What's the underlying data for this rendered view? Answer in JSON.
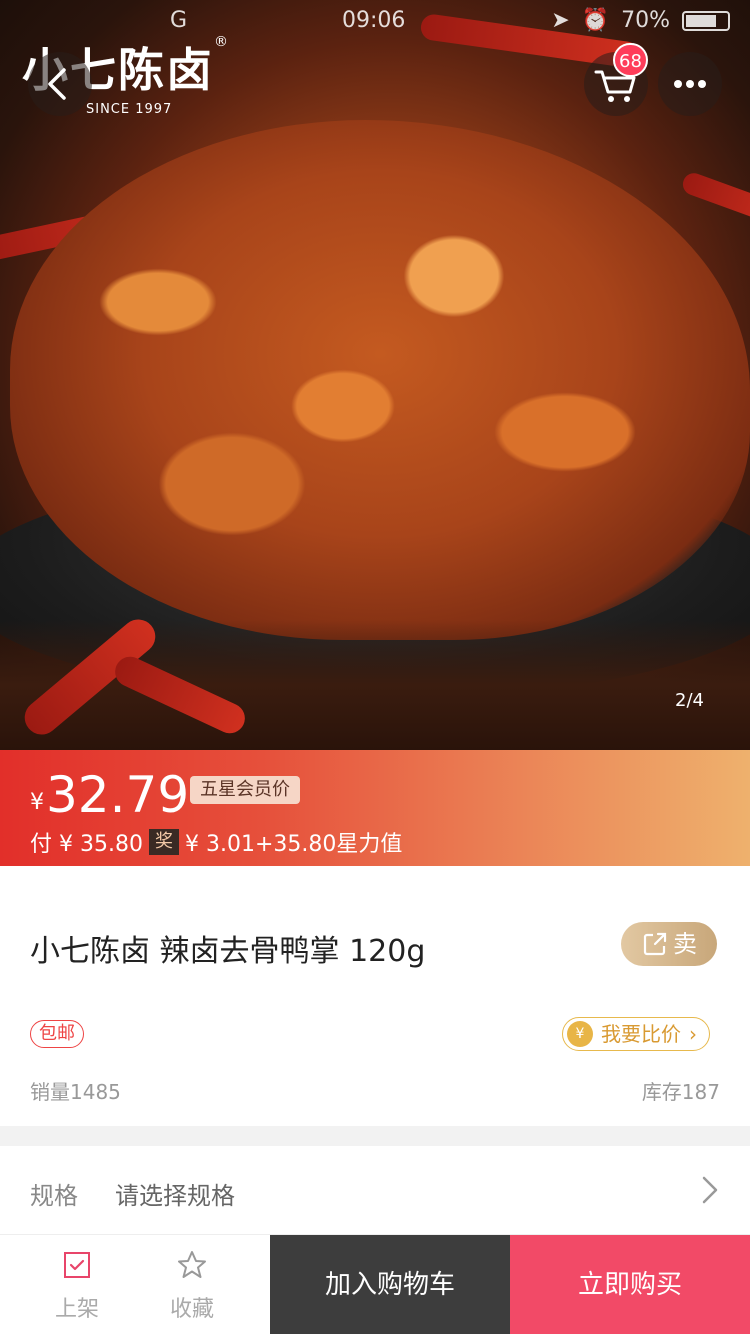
{
  "status_bar": {
    "carrier": "G",
    "time": "09:06",
    "battery": "70%"
  },
  "brand": {
    "name": "小七陈卤",
    "registered": "®",
    "since": "SINCE 1997"
  },
  "header": {
    "cart_count": "68"
  },
  "gallery": {
    "counter": "2/4"
  },
  "price": {
    "currency": "¥",
    "amount": "32.79",
    "member_tag": "五星会员价",
    "pay_text": "付 ¥ 35.80",
    "award_label": "奖",
    "award_text": "¥ 3.01+35.80星力值"
  },
  "product": {
    "title": "小七陈卤 辣卤去骨鸭掌 120g",
    "sell_label": "卖",
    "free_shipping": "包邮",
    "compare_label": "我要比价",
    "sales": "销量1485",
    "stock": "库存187"
  },
  "spec": {
    "label": "规格",
    "value": "请选择规格"
  },
  "bottom_bar": {
    "shelf_label": "上架",
    "favorite_label": "收藏",
    "add_to_cart": "加入购物车",
    "buy_now": "立即购买"
  },
  "colors": {
    "price_gradient_start": "#e22f2a",
    "price_gradient_end": "#eeb16d",
    "buy_now": "#f24a67",
    "add_cart": "#3d3d3d",
    "free_shipping": "#e44444",
    "compare": "#d99a32"
  }
}
